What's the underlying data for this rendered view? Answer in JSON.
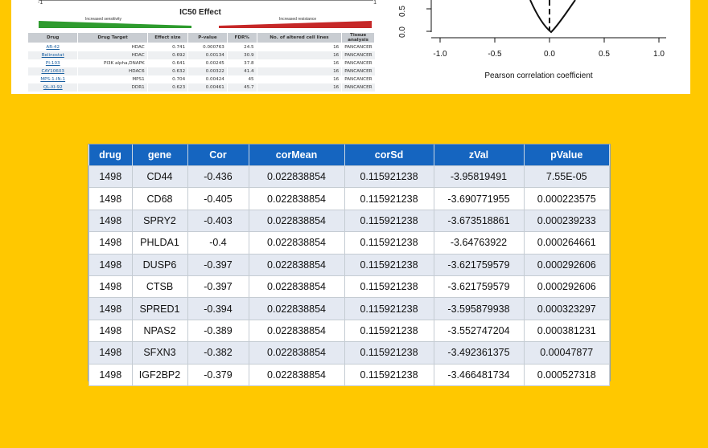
{
  "ic50_panel": {
    "axis_min": "-1",
    "axis_max": "1",
    "title": "IC50 Effect",
    "sensitivity_label": "Increased sensitivity",
    "resistance_label": "Increased resistance",
    "columns": [
      "Drug",
      "Drug Target",
      "Effect size",
      "P-value",
      "FDR%",
      "No. of altered cell lines",
      "Tissue analysis"
    ],
    "rows": [
      [
        "AR-42",
        "HDAC",
        "0.741",
        "0.000763",
        "24.5",
        "16",
        "PANCANCER"
      ],
      [
        "Belinostat",
        "HDAC",
        "0.692",
        "0.00134",
        "30.9",
        "16",
        "PANCANCER"
      ],
      [
        "PI-103",
        "PI3K alpha,DNAPK",
        "0.641",
        "0.00245",
        "37.8",
        "16",
        "PANCANCER"
      ],
      [
        "CAY10603",
        "HDAC6",
        "0.632",
        "0.00322",
        "41.4",
        "16",
        "PANCANCER"
      ],
      [
        "MPS-1-IN-1",
        "MPS1",
        "0.704",
        "0.00424",
        "45",
        "16",
        "PANCANCER"
      ],
      [
        "QL-XI-92",
        "DDR1",
        "0.623",
        "0.00461",
        "45.7",
        "16",
        "PANCANCER"
      ]
    ]
  },
  "density_plot": {
    "x_ticks": [
      "-1.0",
      "-0.5",
      "0.0",
      "0.5",
      "1.0"
    ],
    "y_ticks": [
      "0.5",
      "0.0"
    ],
    "xlabel": "Pearson correlation coefficient"
  },
  "correlation_table": {
    "columns": [
      "drug",
      "gene",
      "Cor",
      "corMean",
      "corSd",
      "zVal",
      "pValue"
    ],
    "rows": [
      [
        "1498",
        "CD44",
        "-0.436",
        "0.022838854",
        "0.115921238",
        "-3.95819491",
        "7.55E-05"
      ],
      [
        "1498",
        "CD68",
        "-0.405",
        "0.022838854",
        "0.115921238",
        "-3.690771955",
        "0.000223575"
      ],
      [
        "1498",
        "SPRY2",
        "-0.403",
        "0.022838854",
        "0.115921238",
        "-3.673518861",
        "0.000239233"
      ],
      [
        "1498",
        "PHLDA1",
        "-0.4",
        "0.022838854",
        "0.115921238",
        "-3.64763922",
        "0.000264661"
      ],
      [
        "1498",
        "DUSP6",
        "-0.397",
        "0.022838854",
        "0.115921238",
        "-3.621759579",
        "0.000292606"
      ],
      [
        "1498",
        "CTSB",
        "-0.397",
        "0.022838854",
        "0.115921238",
        "-3.621759579",
        "0.000292606"
      ],
      [
        "1498",
        "SPRED1",
        "-0.394",
        "0.022838854",
        "0.115921238",
        "-3.595879938",
        "0.000323297"
      ],
      [
        "1498",
        "NPAS2",
        "-0.389",
        "0.022838854",
        "0.115921238",
        "-3.552747204",
        "0.000381231"
      ],
      [
        "1498",
        "SFXN3",
        "-0.382",
        "0.022838854",
        "0.115921238",
        "-3.492361375",
        "0.00047877"
      ],
      [
        "1498",
        "IGF2BP2",
        "-0.379",
        "0.022838854",
        "0.115921238",
        "-3.466481734",
        "0.000527318"
      ]
    ]
  },
  "colors": {
    "background": "#FFC800",
    "header_blue": "#1565c0",
    "row_alt": "#e4e9f2",
    "sensitivity_green": "#2e9b2e",
    "resistance_red": "#c62828"
  }
}
